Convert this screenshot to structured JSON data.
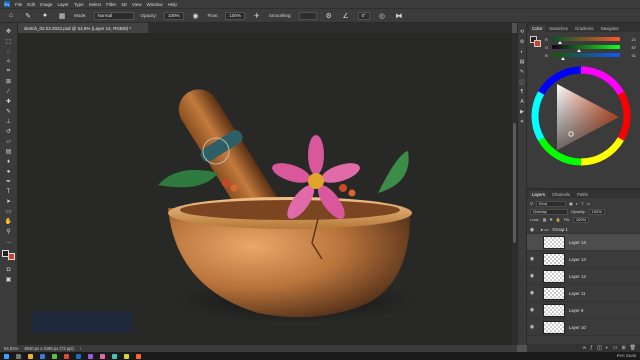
{
  "menu": {
    "items": [
      "File",
      "Edit",
      "Image",
      "Layer",
      "Type",
      "Select",
      "Filter",
      "3D",
      "View",
      "Window",
      "Help"
    ]
  },
  "options": {
    "mode_label": "Mode:",
    "mode_value": "Normal",
    "opacity_label": "Opacity:",
    "opacity_value": "100%",
    "flow_label": "Flow:",
    "flow_value": "100%",
    "smoothing_label": "Smoothing:",
    "smoothing_value": "",
    "angle_value": "0°"
  },
  "document": {
    "tab_title": "sketch_02.03.2022.psd @ 54,9% (Layer 14, RGB/8) *"
  },
  "status": {
    "zoom": "54,91%",
    "doc_size": "3840 px x 2160 px (72 ppi)"
  },
  "color_panel": {
    "tabs": [
      "Color",
      "Swatches",
      "Gradients",
      "Navigator"
    ],
    "sliders": [
      {
        "label": "R",
        "value": "21"
      },
      {
        "label": "G",
        "value": "87"
      },
      {
        "label": "B",
        "value": "31"
      }
    ],
    "accent": "#e05a2a"
  },
  "layers_panel": {
    "tabs": [
      "Layers",
      "Channels",
      "Paths"
    ],
    "filter_label": "Kind",
    "blend_mode": "Overlay",
    "opacity_label": "Opacity:",
    "opacity_value": "100%",
    "lock_label": "Lock:",
    "fill_label": "Fill:",
    "fill_value": "100%",
    "layers": [
      {
        "name": "Group 1",
        "type": "group"
      },
      {
        "name": "Layer 14",
        "selected": true
      },
      {
        "name": "Layer 13"
      },
      {
        "name": "Layer 12"
      },
      {
        "name": "Layer 11"
      },
      {
        "name": "Layer 9"
      },
      {
        "name": "Layer 10"
      }
    ]
  },
  "taskbar": {
    "lang": "РУС",
    "time": "23:00"
  },
  "colors": {
    "ui_dark": "#3b3b3b",
    "canvas_bg": "#282826",
    "selected_layer": "#4d4d4d"
  }
}
